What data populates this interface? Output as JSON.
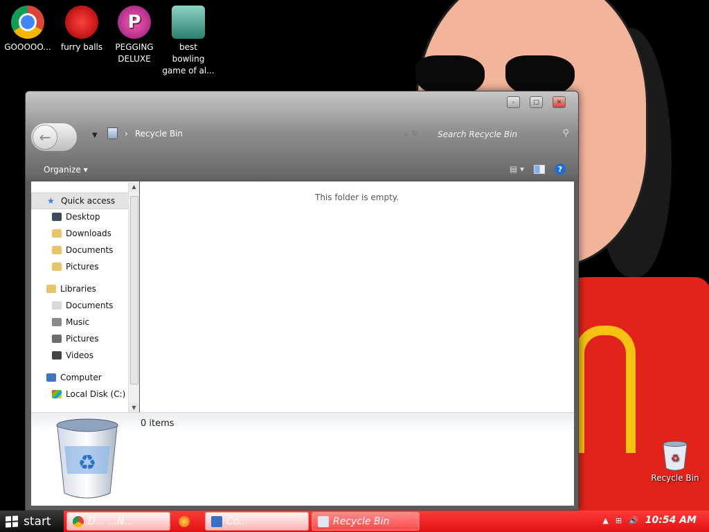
{
  "desktop": {
    "icons": [
      {
        "label": "GOOOOO..."
      },
      {
        "label": "furry balls"
      },
      {
        "label": "PEGGING DELUXE"
      },
      {
        "label": "best bowling game of al..."
      }
    ],
    "recycle_bin_label": "Recycle Bin"
  },
  "window": {
    "address": {
      "crumb": "Recycle Bin"
    },
    "search": {
      "placeholder": "Search Recycle Bin"
    },
    "toolbar": {
      "organize_label": "Organize"
    },
    "nav": {
      "quick_access": "Quick access",
      "desktop": "Desktop",
      "downloads": "Downloads",
      "documents": "Documents",
      "pictures": "Pictures",
      "libraries": "Libraries",
      "lib_documents": "Documents",
      "music": "Music",
      "lib_pictures": "Pictures",
      "videos": "Videos",
      "computer": "Computer",
      "local_disk": "Local Disk (C:)"
    },
    "content": {
      "empty_text": "This folder is empty."
    },
    "details": {
      "item_count": "0 items"
    }
  },
  "taskbar": {
    "start_label": "start",
    "buttons": [
      {
        "label": "D...   ...N..."
      },
      {
        "label": "Co..."
      },
      {
        "label": "Recycle Bin"
      }
    ],
    "clock": "10:54 AM"
  },
  "colors": {
    "taskbar": "#e01010",
    "accent": "#1f6fd1"
  }
}
